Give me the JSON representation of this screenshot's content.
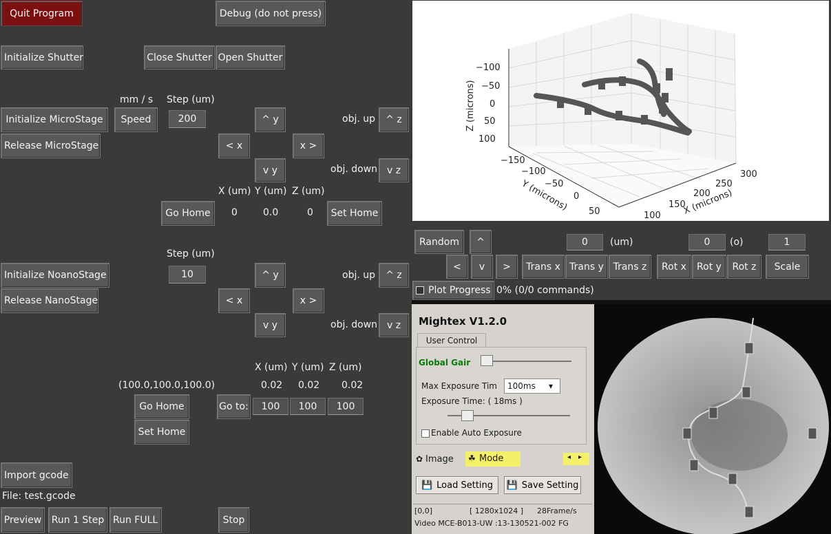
{
  "left_panel": {
    "quit_label": "Quit Program",
    "debug_label": "Debug (do not press)",
    "init_shutter_label": "Initialize Shutter",
    "close_shutter_label": "Close Shutter",
    "open_shutter_label": "Open Shutter",
    "micro": {
      "mms_label": "mm / s",
      "step_header": "Step (um)",
      "init_label": "Initialize MicroStage",
      "speed_label": "Speed",
      "step_value": "200",
      "up_y": "^ y",
      "obj_up_label": "obj. up",
      "up_z": "^ z",
      "release_label": "Release MicroStage",
      "left_x": "< x",
      "right_x": "x >",
      "down_y": "v y",
      "obj_down_label": "obj. down",
      "down_z": "v z",
      "x_header": "X (um)",
      "y_header": "Y (um)",
      "z_header": "Z (um)",
      "go_home_label": "Go Home",
      "x_value": "0",
      "y_value": "0.0",
      "z_value": "0",
      "set_home_label": "Set Home"
    },
    "nano": {
      "step_header": "Step (um)",
      "init_label": "Initialize NoanoStage",
      "step_value": "10",
      "up_y": "^ y",
      "obj_up_label": "obj. up",
      "up_z": "^ z",
      "release_label": "Release NanoStage",
      "left_x": "< x",
      "right_x": "x >",
      "down_y": "v y",
      "obj_down_label": "obj. down",
      "down_z": "v z",
      "x_header": "X (um)",
      "y_header": "Y (um)",
      "z_header": "Z (um)",
      "home_coords": "(100.0,100.0,100.0)",
      "x_value": "0.02",
      "y_value": "0.02",
      "z_value": "0.02",
      "go_home_label": "Go Home",
      "goto_label": "Go to:",
      "goto_x": "100",
      "goto_y": "100",
      "goto_z": "100",
      "set_home_label": "Set Home"
    },
    "gcode": {
      "import_label": "Import gcode",
      "file_label": "File: test.gcode",
      "preview_label": "Preview",
      "run_step_label": "Run 1 Step",
      "run_full_label": "Run FULL",
      "stop_label": "Stop"
    }
  },
  "plot_controls": {
    "random_label": "Random",
    "up_label": "^",
    "trans_value": "0",
    "trans_unit": "(um)",
    "rot_value": "0",
    "rot_unit": "(o)",
    "scale_value": "1",
    "left_label": "<",
    "down_label": "v",
    "right_label": ">",
    "trans_x_label": "Trans x",
    "trans_y_label": "Trans y",
    "trans_z_label": "Trans z",
    "rot_x_label": "Rot x",
    "rot_y_label": "Rot y",
    "rot_z_label": "Rot z",
    "scale_label": "Scale",
    "plot_progress_label": "Plot Progress",
    "progress_text": "0% (0/0 commands)"
  },
  "plot3d": {
    "z_label": "Z (microns)",
    "y_label": "Y (microns)",
    "x_label": "X (microns)",
    "z_ticks": [
      "−100",
      "−50",
      "0",
      "50",
      "100"
    ],
    "y_ticks": [
      "−150",
      "−100",
      "−50",
      "0",
      "50"
    ],
    "x_ticks": [
      "100",
      "150",
      "200",
      "250",
      "300"
    ]
  },
  "mightex": {
    "title": "Mightex V1.2.0",
    "tab_label": "User Control",
    "global_gain_label": "Global Gair",
    "max_exposure_label": "Max Exposure Tim",
    "max_exposure_value": "100ms",
    "exposure_time_label": "Exposure Time: ( 18ms )",
    "auto_exposure_label": "Enable Auto Exposure",
    "image_tab_label": "Image",
    "mode_tab_label": "Mode",
    "load_label": "Load Setting",
    "save_label": "Save Setting",
    "status_coords": "[0,0]",
    "status_resolution": "[ 1280x1024 ]",
    "status_fps": "28Frame/s",
    "status_video": "Video   MCE-B013-UW :13-130521-002  FG"
  },
  "colors": {
    "background": "#3a3a3a",
    "button": "#585858",
    "quit_button": "#7b1010",
    "global_gain": "#0a7a0a"
  }
}
